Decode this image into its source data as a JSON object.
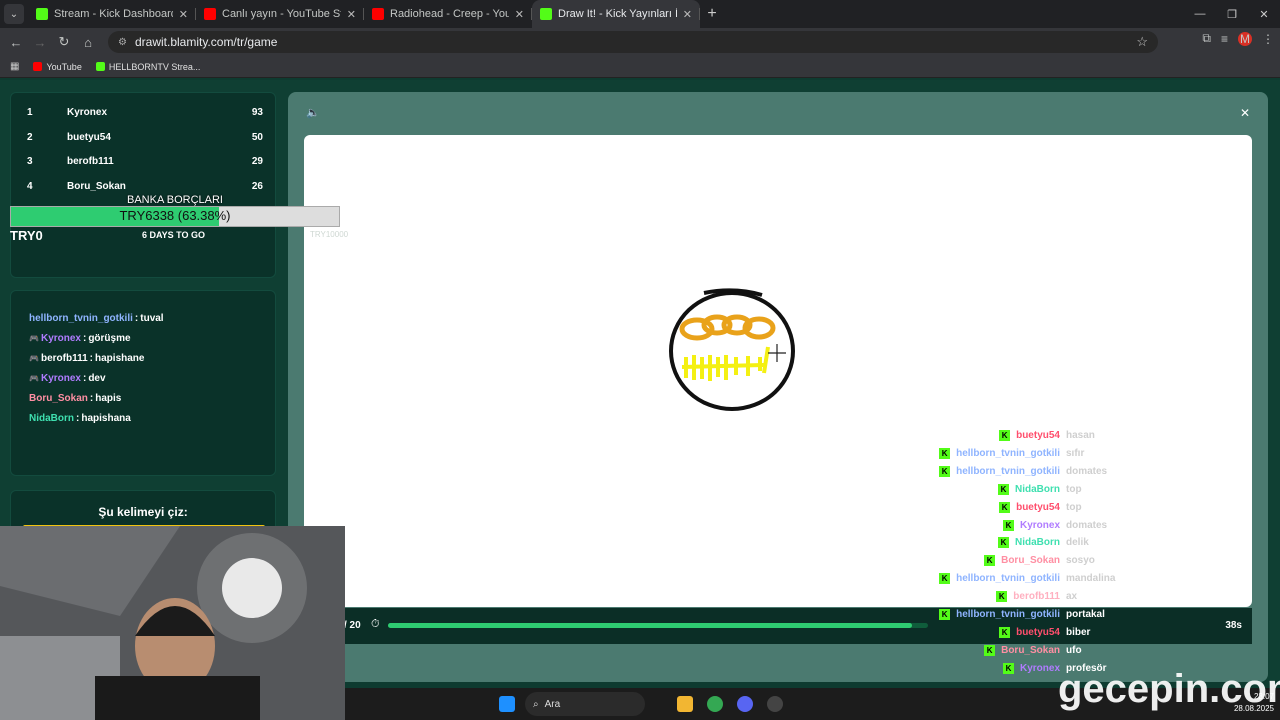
{
  "tabs": [
    {
      "title": "Stream - Kick Dashboard",
      "favicon_color": "#53fc18",
      "active": false
    },
    {
      "title": "Canlı yayın - YouTube Studio",
      "favicon_color": "#ff0000",
      "active": false
    },
    {
      "title": "Radiohead - Creep - YouTube",
      "favicon_color": "#ff0000",
      "active": false
    },
    {
      "title": "Draw It! - Kick Yayınları İçin Çizim",
      "favicon_color": "#53fc18",
      "active": true
    }
  ],
  "address": "drawit.blamity.com/tr/game",
  "avatar_letter": "M",
  "bookmarks": [
    {
      "label": "YouTube",
      "color": "#ff0000"
    },
    {
      "label": "HELLBORNTV Strea...",
      "color": "#53fc18"
    }
  ],
  "leaderboard": [
    {
      "rank": "1",
      "name": "Kyronex",
      "score": "93"
    },
    {
      "rank": "2",
      "name": "buetyu54",
      "score": "50"
    },
    {
      "rank": "3",
      "name": "berofb111",
      "score": "29"
    },
    {
      "rank": "4",
      "name": "Boru_Sokan",
      "score": "26"
    }
  ],
  "donation": {
    "title": "BANKA BORÇLARI",
    "amount": "TRY6338 (63.38%)",
    "progress": 0.6338,
    "left": "TRY0",
    "days": "6 DAYS TO GO",
    "right": "TRY10000"
  },
  "side_chat": [
    {
      "user": "hellborn_tvnin_gotkili",
      "msg": "tuval",
      "color": "#8fb4ff",
      "badge": false
    },
    {
      "user": "Kyronex",
      "msg": "görüşme",
      "color": "#b07cff",
      "badge": true
    },
    {
      "user": "berofb111",
      "msg": "hapishane",
      "color": "#ffffff",
      "badge": true
    },
    {
      "user": "Kyronex",
      "msg": "dev",
      "color": "#b07cff",
      "badge": true
    },
    {
      "user": "Boru_Sokan",
      "msg": "hapis",
      "color": "#ff8fa3",
      "badge": false
    },
    {
      "user": "NidaBorn",
      "msg": "hapishana",
      "color": "#3fe0b0",
      "badge": false
    }
  ],
  "draw_prompt": "Şu kelimeyi çiz:",
  "round": "/ 20",
  "timer_text": "38s",
  "timer_progress": 0.97,
  "game_chat": [
    {
      "user": "buetyu54",
      "word": "hasan",
      "color": "#ff4f6d",
      "word_color": "#cfcfcf"
    },
    {
      "user": "hellborn_tvnin_gotkili",
      "word": "sıfır",
      "color": "#8fb4ff",
      "word_color": "#cfcfcf"
    },
    {
      "user": "hellborn_tvnin_gotkili",
      "word": "domates",
      "color": "#8fb4ff",
      "word_color": "#cfcfcf"
    },
    {
      "user": "NidaBorn",
      "word": "top",
      "color": "#3fe0b0",
      "word_color": "#cfcfcf"
    },
    {
      "user": "buetyu54",
      "word": "top",
      "color": "#ff4f6d",
      "word_color": "#cfcfcf"
    },
    {
      "user": "Kyronex",
      "word": "domates",
      "color": "#b07cff",
      "word_color": "#cfcfcf"
    },
    {
      "user": "NidaBorn",
      "word": "delik",
      "color": "#3fe0b0",
      "word_color": "#cfcfcf"
    },
    {
      "user": "Boru_Sokan",
      "word": "sosyo",
      "color": "#ff8fa3",
      "word_color": "#cfcfcf"
    },
    {
      "user": "hellborn_tvnin_gotkili",
      "word": "mandalina",
      "color": "#8fb4ff",
      "word_color": "#cfcfcf"
    },
    {
      "user": "berofb111",
      "word": "ax",
      "color": "#ffb0c0",
      "word_color": "#cfcfcf"
    },
    {
      "user": "hellborn_tvnin_gotkili",
      "word": "portakal",
      "color": "#8fb4ff",
      "word_color": "#ffffff"
    },
    {
      "user": "buetyu54",
      "word": "biber",
      "color": "#ff4f6d",
      "word_color": "#ffffff"
    },
    {
      "user": "Boru_Sokan",
      "word": "ufo",
      "color": "#ff8fa3",
      "word_color": "#ffffff"
    },
    {
      "user": "Kyronex",
      "word": "profesör",
      "color": "#b07cff",
      "word_color": "#ffffff"
    }
  ],
  "taskbar": {
    "search": "Ara",
    "time": "23:07",
    "date": "28.08.2025"
  },
  "watermark": "gecepin.com",
  "colors": {
    "kick_green": "#53fc18",
    "progress_green": "#2ecc71",
    "page_bg": "#0f3f33"
  }
}
